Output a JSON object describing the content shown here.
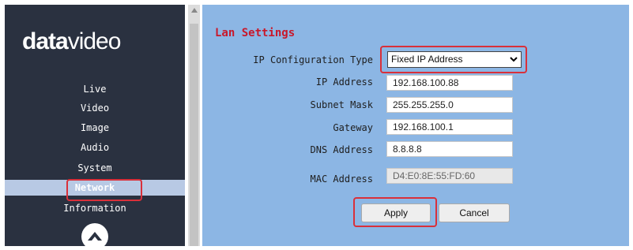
{
  "sidebar": {
    "logo": {
      "bold": "data",
      "light": "video"
    },
    "items": [
      {
        "label": "Live",
        "active": false
      },
      {
        "label": "Video",
        "active": false
      },
      {
        "label": "Image",
        "active": false
      },
      {
        "label": "Audio",
        "active": false
      },
      {
        "label": "System",
        "active": false
      },
      {
        "label": "Network",
        "active": true
      },
      {
        "label": "Information",
        "active": false
      }
    ],
    "up_icon": "chevron-up-circle-icon"
  },
  "main": {
    "title": "Lan Settings",
    "ip_config": {
      "label": "IP Configuration Type",
      "value": "Fixed IP Address"
    },
    "fields": [
      {
        "label": "IP Address",
        "value": "192.168.100.88",
        "readonly": false
      },
      {
        "label": "Subnet Mask",
        "value": "255.255.255.0",
        "readonly": false
      },
      {
        "label": "Gateway",
        "value": "192.168.100.1",
        "readonly": false
      },
      {
        "label": "DNS Address",
        "value": "8.8.8.8",
        "readonly": false
      },
      {
        "label": "MAC Address",
        "value": "D4:E0:8E:55:FD:60",
        "readonly": true
      }
    ],
    "buttons": {
      "apply": "Apply",
      "cancel": "Cancel"
    }
  },
  "colors": {
    "sidebar_bg": "#2a3140",
    "main_bg": "#8cb6e4",
    "title": "#c8182b",
    "highlight": "#d9303a",
    "active_nav": "#b8c9e4"
  }
}
